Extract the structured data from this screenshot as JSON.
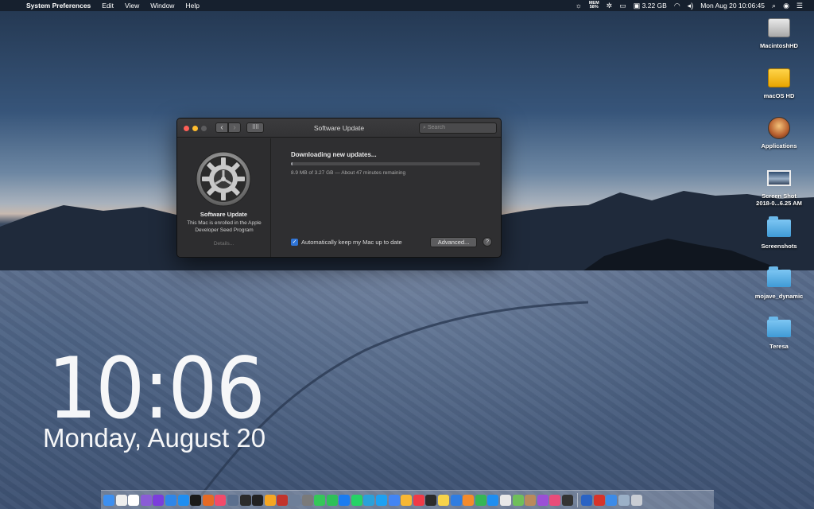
{
  "menubar": {
    "apple_icon": "apple-icon",
    "app_name": "System Preferences",
    "menus": [
      "Edit",
      "View",
      "Window",
      "Help"
    ],
    "memory_label": "MEM",
    "memory_value": "58%",
    "storage": "3.22 GB",
    "clock": "Mon Aug 20  10:06:45"
  },
  "desktop": {
    "items": [
      {
        "label": "MacintoshHD",
        "icon": "hard-drive-icon"
      },
      {
        "label": "macOS HD",
        "icon": "external-drive-icon"
      },
      {
        "label": "Applications",
        "icon": "applications-icon"
      },
      {
        "label": "Screen Shot\n2018-0...6.25 AM",
        "icon": "screenshot-file-icon"
      },
      {
        "label": "Screenshots",
        "icon": "folder-icon"
      },
      {
        "label": "mojave_dynamic",
        "icon": "folder-icon"
      },
      {
        "label": "Teresa",
        "icon": "folder-icon"
      }
    ]
  },
  "clock_widget": {
    "time": "10:06",
    "date": "Monday, August 20"
  },
  "window": {
    "title": "Software Update",
    "search_placeholder": "Search",
    "nav_back": "‹",
    "nav_forward": "›",
    "grid_glyph": "⠿⠿",
    "sidebar": {
      "name": "Software Update",
      "note": "This Mac is enrolled in the Apple Developer Seed Program",
      "details_link": "Details..."
    },
    "status": "Downloading new updates...",
    "progress_fraction": 0.003,
    "progress_detail": "8.9 MB of 3.27 GB — About 47 minutes remaining",
    "auto_update_label": "Automatically keep my Mac up to date",
    "auto_update_checked": true,
    "advanced_button": "Advanced...",
    "help_button": "?"
  },
  "dock": {
    "icons": [
      {
        "name": "finder-icon",
        "color": "#3d8ff0"
      },
      {
        "name": "clock-icon",
        "color": "#eeeeee"
      },
      {
        "name": "calendar-icon",
        "color": "#ffffff"
      },
      {
        "name": "launchpad-icon",
        "color": "#8a5cd6"
      },
      {
        "name": "siri-icon",
        "color": "#7b3ddc"
      },
      {
        "name": "safari-icon",
        "color": "#2f86e8"
      },
      {
        "name": "app-store-icon",
        "color": "#1f8ef1"
      },
      {
        "name": "opera-icon",
        "color": "#1a1a1a"
      },
      {
        "name": "firefox-icon",
        "color": "#e56a25"
      },
      {
        "name": "music-icon",
        "color": "#f24a6a"
      },
      {
        "name": "rocket-icon",
        "color": "#5b6f8e"
      },
      {
        "name": "dashboard-icon",
        "color": "#2b2b2b"
      },
      {
        "name": "terminal-icon",
        "color": "#222222"
      },
      {
        "name": "photos-icon",
        "color": "#f5a623"
      },
      {
        "name": "photo-booth-icon",
        "color": "#c2342c"
      },
      {
        "name": "preview-icon",
        "color": "#6e7f99"
      },
      {
        "name": "system-prefs-icon",
        "color": "#7a7a7a"
      },
      {
        "name": "messages-icon",
        "color": "#35c759"
      },
      {
        "name": "facetime-icon",
        "color": "#2ec058"
      },
      {
        "name": "messenger-icon",
        "color": "#1a7cf0"
      },
      {
        "name": "whatsapp-icon",
        "color": "#25d366"
      },
      {
        "name": "telegram-icon",
        "color": "#2aa1da"
      },
      {
        "name": "twitter-icon",
        "color": "#1da1f2"
      },
      {
        "name": "chrome-icon",
        "color": "#4285f4"
      },
      {
        "name": "home-icon",
        "color": "#f7b733"
      },
      {
        "name": "news-icon",
        "color": "#f03a47"
      },
      {
        "name": "stocks-icon",
        "color": "#2b2b2b"
      },
      {
        "name": "notes-icon",
        "color": "#f6d34a"
      },
      {
        "name": "keynote-icon",
        "color": "#2f7de1"
      },
      {
        "name": "pages-icon",
        "color": "#f58b2b"
      },
      {
        "name": "numbers-icon",
        "color": "#35b655"
      },
      {
        "name": "xcode-icon",
        "color": "#1e8ef0"
      },
      {
        "name": "textedit-icon",
        "color": "#e8e8e8"
      },
      {
        "name": "maps-icon",
        "color": "#6fbf5a"
      },
      {
        "name": "contacts-icon",
        "color": "#b98a5c"
      },
      {
        "name": "podcasts-icon",
        "color": "#9b4fd6"
      },
      {
        "name": "itunes-icon",
        "color": "#e94c7a"
      },
      {
        "name": "voice-memos-icon",
        "color": "#333333"
      }
    ],
    "trailing_icons": [
      {
        "name": "downloads-icon",
        "color": "#2b63c4"
      },
      {
        "name": "adobe-icon",
        "color": "#d7342b"
      },
      {
        "name": "mail-icon",
        "color": "#3c8be8"
      },
      {
        "name": "screenshot-stack-icon",
        "color": "#9bb0c7"
      },
      {
        "name": "trash-icon",
        "color": "#c8ccd3"
      }
    ]
  }
}
